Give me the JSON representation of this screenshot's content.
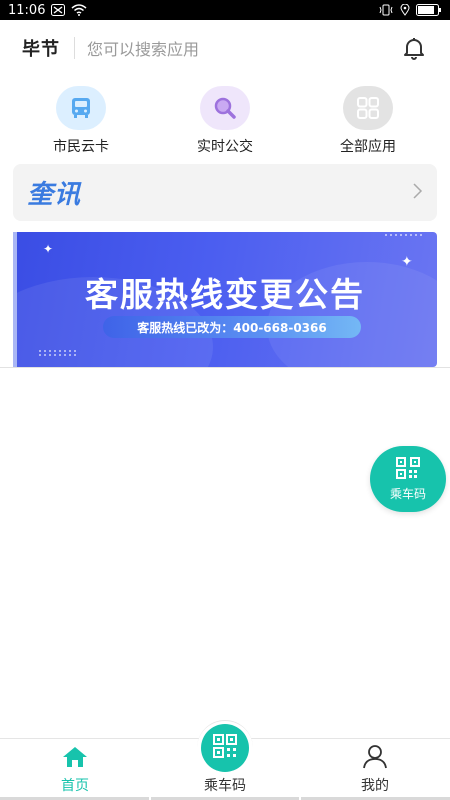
{
  "status_bar": {
    "time": "11:06"
  },
  "header": {
    "city": "毕节",
    "search_placeholder": "您可以搜索应用"
  },
  "entries": [
    {
      "label": "市民云卡",
      "icon": "bus-icon",
      "bg": "#dcefff",
      "fg": "#57a9f0"
    },
    {
      "label": "实时公交",
      "icon": "search-icon",
      "bg": "#efe6fb",
      "fg": "#9d72dd"
    },
    {
      "label": "全部应用",
      "icon": "grid-icon",
      "bg": "#e3e3e3",
      "fg": "#ffffff"
    }
  ],
  "news": {
    "logo": "奎讯"
  },
  "banner": {
    "title": "客服热线变更公告",
    "subtitle": "客服热线已改为：400-668-0366"
  },
  "float_button": {
    "label": "乘车码"
  },
  "bottom_nav": [
    {
      "label": "首页",
      "active": true
    },
    {
      "label": "乘车码",
      "active": false
    },
    {
      "label": "我的",
      "active": false
    }
  ],
  "colors": {
    "accent": "#17c3ac",
    "banner": "#3a4de4"
  }
}
